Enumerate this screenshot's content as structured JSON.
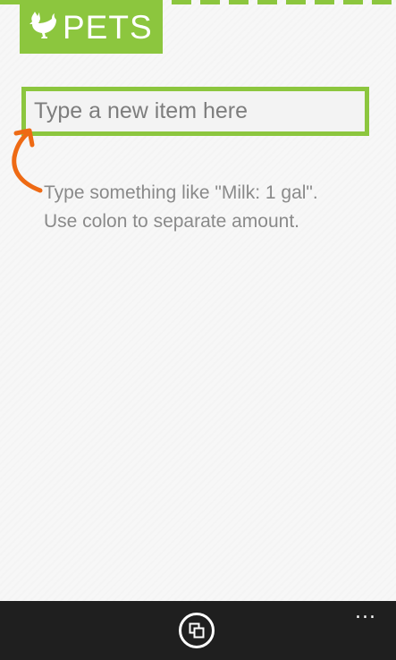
{
  "app": {
    "title": "PETS",
    "logo_icon": "hen-icon",
    "accent_color": "#8cc63e"
  },
  "new_item": {
    "placeholder": "Type a new item here",
    "value": ""
  },
  "hint": {
    "line1": "Type something like \"Milk: 1 gal\".",
    "line2": "Use colon to separate amount.",
    "pointer_icon": "curved-arrow-icon",
    "pointer_color": "#ee6a14"
  },
  "appbar": {
    "button_icon": "copy-icon",
    "more_label": "..."
  }
}
